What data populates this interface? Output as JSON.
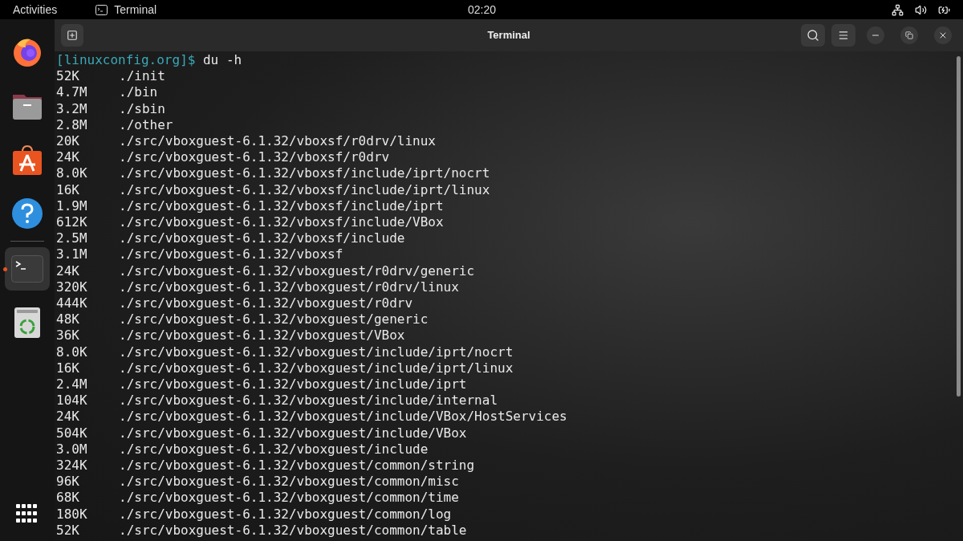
{
  "top_bar": {
    "activities": "Activities",
    "app_name": "Terminal",
    "clock": "02:20"
  },
  "dock": {
    "items": [
      {
        "kind": "firefox",
        "running": false
      },
      {
        "kind": "files",
        "running": false
      },
      {
        "kind": "software",
        "running": false
      },
      {
        "kind": "help",
        "running": false
      },
      {
        "kind": "terminal",
        "running": true
      },
      {
        "kind": "trash",
        "running": false
      }
    ]
  },
  "window": {
    "title": "Terminal"
  },
  "terminal": {
    "prompt": "[linuxconfig.org]$",
    "command": "du -h",
    "rows": [
      {
        "size": "52K",
        "path": "./init"
      },
      {
        "size": "4.7M",
        "path": "./bin"
      },
      {
        "size": "3.2M",
        "path": "./sbin"
      },
      {
        "size": "2.8M",
        "path": "./other"
      },
      {
        "size": "20K",
        "path": "./src/vboxguest-6.1.32/vboxsf/r0drv/linux"
      },
      {
        "size": "24K",
        "path": "./src/vboxguest-6.1.32/vboxsf/r0drv"
      },
      {
        "size": "8.0K",
        "path": "./src/vboxguest-6.1.32/vboxsf/include/iprt/nocrt"
      },
      {
        "size": "16K",
        "path": "./src/vboxguest-6.1.32/vboxsf/include/iprt/linux"
      },
      {
        "size": "1.9M",
        "path": "./src/vboxguest-6.1.32/vboxsf/include/iprt"
      },
      {
        "size": "612K",
        "path": "./src/vboxguest-6.1.32/vboxsf/include/VBox"
      },
      {
        "size": "2.5M",
        "path": "./src/vboxguest-6.1.32/vboxsf/include"
      },
      {
        "size": "3.1M",
        "path": "./src/vboxguest-6.1.32/vboxsf"
      },
      {
        "size": "24K",
        "path": "./src/vboxguest-6.1.32/vboxguest/r0drv/generic"
      },
      {
        "size": "320K",
        "path": "./src/vboxguest-6.1.32/vboxguest/r0drv/linux"
      },
      {
        "size": "444K",
        "path": "./src/vboxguest-6.1.32/vboxguest/r0drv"
      },
      {
        "size": "48K",
        "path": "./src/vboxguest-6.1.32/vboxguest/generic"
      },
      {
        "size": "36K",
        "path": "./src/vboxguest-6.1.32/vboxguest/VBox"
      },
      {
        "size": "8.0K",
        "path": "./src/vboxguest-6.1.32/vboxguest/include/iprt/nocrt"
      },
      {
        "size": "16K",
        "path": "./src/vboxguest-6.1.32/vboxguest/include/iprt/linux"
      },
      {
        "size": "2.4M",
        "path": "./src/vboxguest-6.1.32/vboxguest/include/iprt"
      },
      {
        "size": "104K",
        "path": "./src/vboxguest-6.1.32/vboxguest/include/internal"
      },
      {
        "size": "24K",
        "path": "./src/vboxguest-6.1.32/vboxguest/include/VBox/HostServices"
      },
      {
        "size": "504K",
        "path": "./src/vboxguest-6.1.32/vboxguest/include/VBox"
      },
      {
        "size": "3.0M",
        "path": "./src/vboxguest-6.1.32/vboxguest/include"
      },
      {
        "size": "324K",
        "path": "./src/vboxguest-6.1.32/vboxguest/common/string"
      },
      {
        "size": "96K",
        "path": "./src/vboxguest-6.1.32/vboxguest/common/misc"
      },
      {
        "size": "68K",
        "path": "./src/vboxguest-6.1.32/vboxguest/common/time"
      },
      {
        "size": "180K",
        "path": "./src/vboxguest-6.1.32/vboxguest/common/log"
      },
      {
        "size": "52K",
        "path": "./src/vboxguest-6.1.32/vboxguest/common/table"
      }
    ]
  }
}
